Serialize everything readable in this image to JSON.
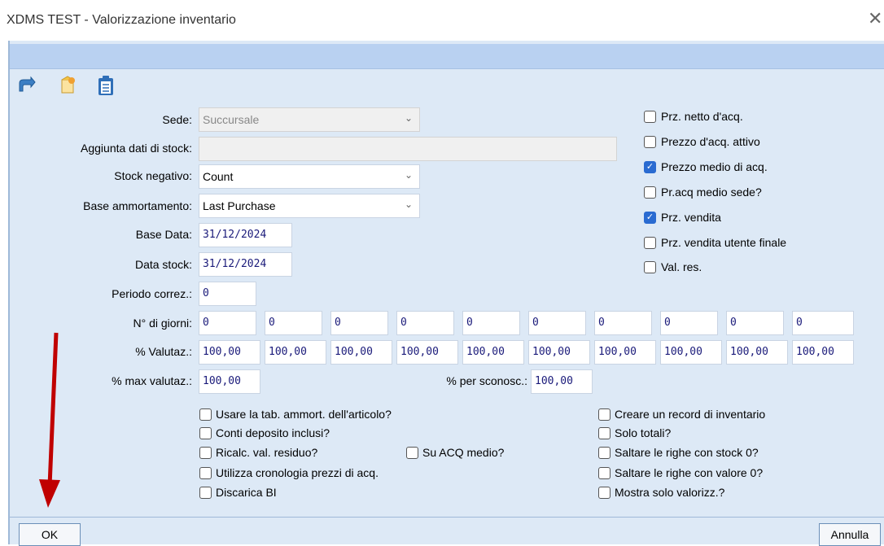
{
  "window": {
    "title": "XDMS TEST  -  Valorizzazione inventario",
    "close_glyph": "✕"
  },
  "toolbar": {
    "icons": [
      "undo-icon",
      "new-document-icon",
      "clipboard-icon"
    ]
  },
  "form": {
    "sede": {
      "label": "Sede:",
      "value": "Succursale"
    },
    "aggiunta": {
      "label": "Aggiunta dati di stock:",
      "value": ""
    },
    "stock_negativo": {
      "label": "Stock negativo:",
      "value": "Count"
    },
    "base_ammortamento": {
      "label": "Base ammortamento:",
      "value": "Last Purchase"
    },
    "base_data": {
      "label": "Base Data:",
      "value": "31/12/2024"
    },
    "data_stock": {
      "label": "Data stock:",
      "value": "31/12/2024"
    },
    "periodo": {
      "label": "Periodo correz.:",
      "value": "0"
    },
    "giorni": {
      "label": "N° di giorni:",
      "values": [
        "0",
        "0",
        "0",
        "0",
        "0",
        "0",
        "0",
        "0",
        "0",
        "0"
      ]
    },
    "valutaz": {
      "label": "% Valutaz.:",
      "values": [
        "100,00",
        "100,00",
        "100,00",
        "100,00",
        "100,00",
        "100,00",
        "100,00",
        "100,00",
        "100,00",
        "100,00"
      ]
    },
    "max_valutaz": {
      "label": "% max valutaz.:",
      "value": "100,00"
    },
    "per_sconosc": {
      "label": "% per sconosc.:",
      "value": "100,00"
    }
  },
  "right_checks": [
    {
      "label": "Prz. netto d'acq.",
      "checked": false
    },
    {
      "label": "Prezzo d'acq. attivo",
      "checked": false
    },
    {
      "label": "Prezzo medio di acq.",
      "checked": true
    },
    {
      "label": "Pr.acq medio sede?",
      "checked": false
    },
    {
      "label": "Prz. vendita",
      "checked": true
    },
    {
      "label": "Prz. vendita utente finale",
      "checked": false
    },
    {
      "label": "Val. res.",
      "checked": false
    }
  ],
  "bottom_left_checks": [
    {
      "label": "Usare la tab. ammort. dell'articolo?",
      "checked": false
    },
    {
      "label": "Conti deposito inclusi?",
      "checked": false
    },
    {
      "label": "Ricalc. val. residuo?",
      "checked": false
    },
    {
      "label": "Utilizza cronologia prezzi di acq.",
      "checked": false
    },
    {
      "label": "Discarica BI",
      "checked": false
    }
  ],
  "mid_check": {
    "label": "Su ACQ medio?",
    "checked": false
  },
  "bottom_right_checks": [
    {
      "label": "Creare un record di inventario",
      "checked": false
    },
    {
      "label": "Solo totali?",
      "checked": false
    },
    {
      "label": "Saltare le righe con stock 0?",
      "checked": false
    },
    {
      "label": "Saltare le righe con valore 0?",
      "checked": false
    },
    {
      "label": "Mostra solo valorizz.?",
      "checked": false
    }
  ],
  "buttons": {
    "ok": "OK",
    "cancel": "Annulla"
  },
  "colors": {
    "dialog_bg": "#dde9f6",
    "band": "#b9d1f1",
    "check_accent": "#2a6bd1",
    "arrow": "#c00000"
  }
}
